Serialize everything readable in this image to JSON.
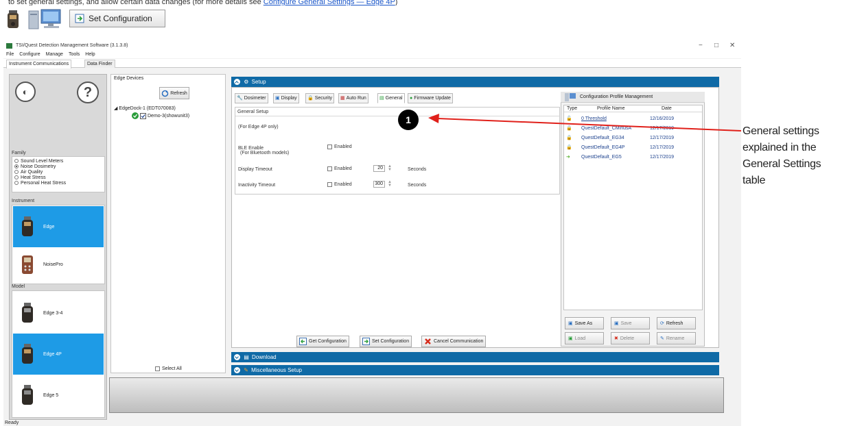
{
  "doc": {
    "caption_prefix": "to set general settings, and allow certain data changes (for more details see",
    "caption_link": "Configure General Settings — Edge 4P",
    "caption_suffix": ")",
    "top_button_label": "Set Configuration"
  },
  "window": {
    "title": "TSI/Quest Detection Management Software (3.1.3.8)",
    "controls": [
      "−",
      "□",
      "✕"
    ]
  },
  "menu": [
    "File",
    "Configure",
    "Manage",
    "Tools",
    "Help"
  ],
  "main_tabs": [
    "Instrument Communications",
    "Data Finder"
  ],
  "left": {
    "family_label": "Family",
    "families": [
      {
        "label": "Sound Level Meters",
        "selected": false
      },
      {
        "label": "Noise Dosimetry",
        "selected": true
      },
      {
        "label": "Air Quality",
        "selected": false
      },
      {
        "label": "Heat Stress",
        "selected": false
      },
      {
        "label": "Personal Heat Stress",
        "selected": false
      }
    ],
    "instrument_label": "Instrument",
    "instruments": [
      {
        "label": "Edge",
        "selected": true
      },
      {
        "label": "NoisePro",
        "selected": false
      }
    ],
    "model_label": "Model",
    "models": [
      {
        "label": "Edge 3-4",
        "selected": false
      },
      {
        "label": "Edge 4P",
        "selected": true
      },
      {
        "label": "Edge 5",
        "selected": false
      }
    ]
  },
  "devices": {
    "title": "Edge Devices",
    "refresh_label": "Refresh",
    "dock": "EdgeDock-1 (EDT070083)",
    "device": "Demo-3(showunit3)",
    "select_all": "Select All"
  },
  "setup": {
    "title": "Setup",
    "tabs": [
      "Dosimeter",
      "Display",
      "Security",
      "Auto Run",
      "General",
      "Firmware Update"
    ],
    "active_tab": "General",
    "general": {
      "heading": "General Setup",
      "note": "(For Edge 4P only)",
      "ble_label": "BLE Enable",
      "ble_sub": "(For Bluetooth models)",
      "ble_enabled": "Enabled",
      "display_timeout_label": "Display Timeout",
      "display_enabled": "Enabled",
      "display_value": "20",
      "display_unit": "Seconds",
      "inactivity_label": "Inactivity Timeout",
      "inactivity_enabled": "Enabled",
      "inactivity_value": "300",
      "inactivity_unit": "Seconds"
    },
    "buttons": {
      "get": "Get Configuration",
      "set": "Set Configuration",
      "cancel": "Cancel Communication"
    }
  },
  "profiles": {
    "title": "Configuration Profile Management",
    "col_type": "Type",
    "col_name": "Profile Name",
    "col_date": "Date",
    "rows": [
      {
        "name": "0 Threshold",
        "date": "12/16/2019"
      },
      {
        "name": "QuestDefault_CMinusA",
        "date": "12/17/2019"
      },
      {
        "name": "QuestDefault_EG34",
        "date": "12/17/2019"
      },
      {
        "name": "QuestDefault_EG4P",
        "date": "12/17/2019"
      },
      {
        "name": "QuestDefault_EG5",
        "date": "12/17/2019"
      }
    ],
    "buttons": {
      "save_as": "Save As",
      "save": "Save",
      "refresh": "Refresh",
      "load": "Load",
      "delete": "Delete",
      "rename": "Rename"
    }
  },
  "sections": {
    "download": "Download",
    "misc": "Miscellaneous Setup"
  },
  "status": "Ready",
  "callout": {
    "number": "1",
    "text": "General settings explained in the General Settings table"
  },
  "colors": {
    "header_blue": "#0f6aa6",
    "selection_blue": "#1e9be6",
    "callout_arrow": "#e0201a"
  }
}
